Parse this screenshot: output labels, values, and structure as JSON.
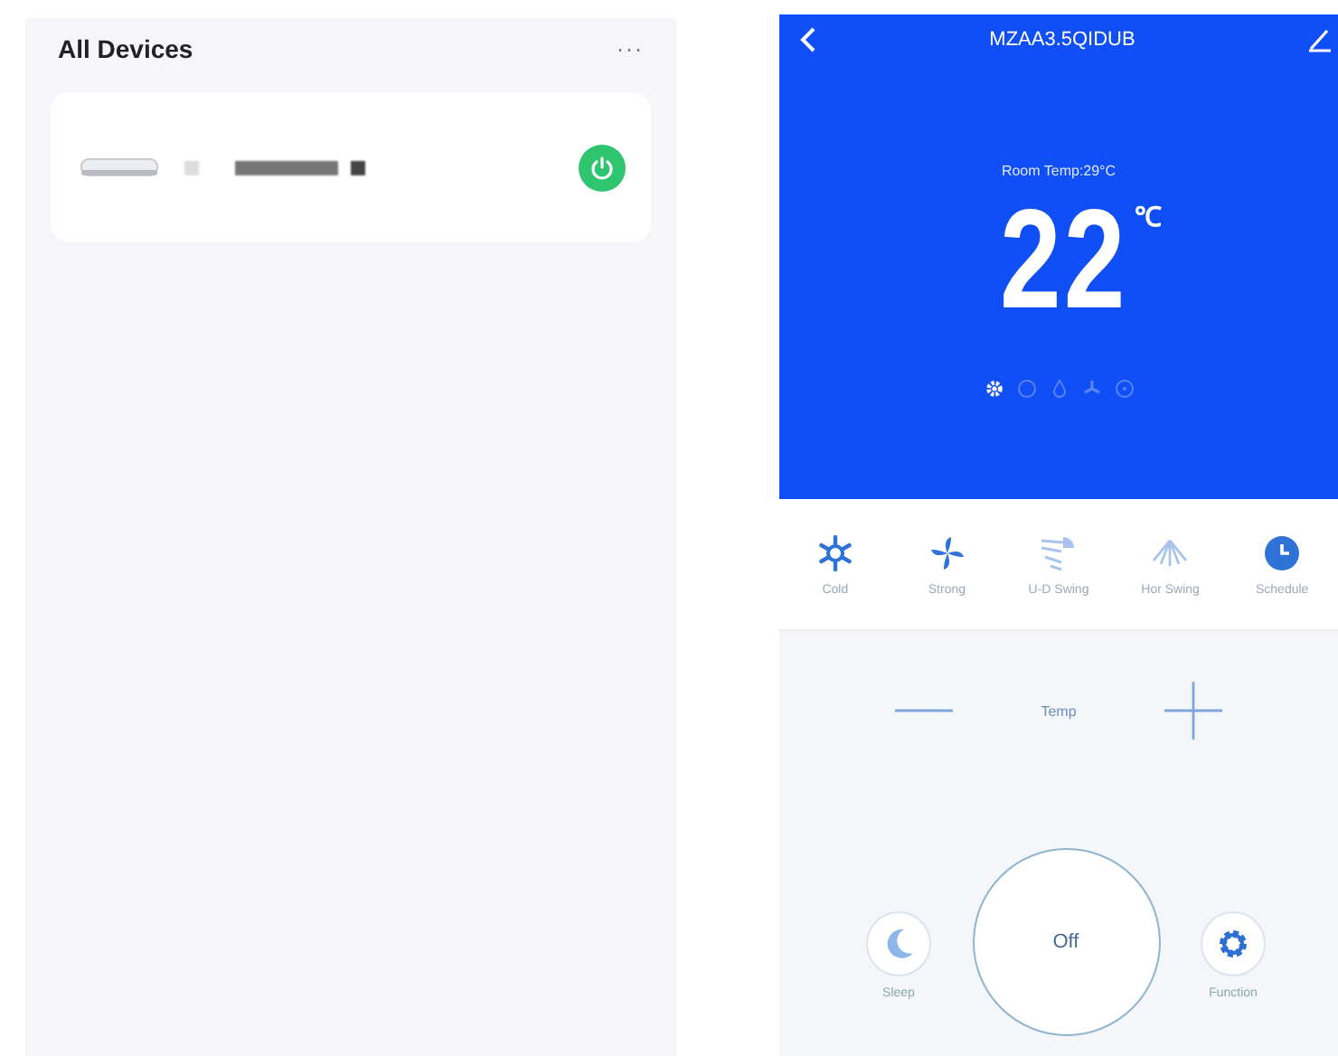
{
  "devices_screen": {
    "title": "All Devices",
    "menu": "···",
    "devices": [
      {
        "on": true
      }
    ]
  },
  "control_screen": {
    "title": "MZAA3.5QIDUB",
    "room_temp": "Room Temp:29°C",
    "set_temp": "22",
    "unit": "℃",
    "mode_indicators": [
      {
        "kind": "gear",
        "selected": true
      },
      {
        "kind": "dot",
        "selected": false
      },
      {
        "kind": "drop",
        "selected": false
      },
      {
        "kind": "fan",
        "selected": false
      },
      {
        "kind": "circle",
        "selected": false
      }
    ],
    "functions": [
      {
        "kind": "snow",
        "label": "Cold",
        "on": true
      },
      {
        "kind": "fan",
        "label": "Strong",
        "on": true
      },
      {
        "kind": "vswing",
        "label": "U-D Swing",
        "on": false
      },
      {
        "kind": "hswing",
        "label": "Hor Swing",
        "on": false
      },
      {
        "kind": "clock",
        "label": "Schedule",
        "on": true
      }
    ],
    "temp_label": "Temp",
    "sleep_label": "Sleep",
    "power_label": "Off",
    "function_label": "Function"
  }
}
